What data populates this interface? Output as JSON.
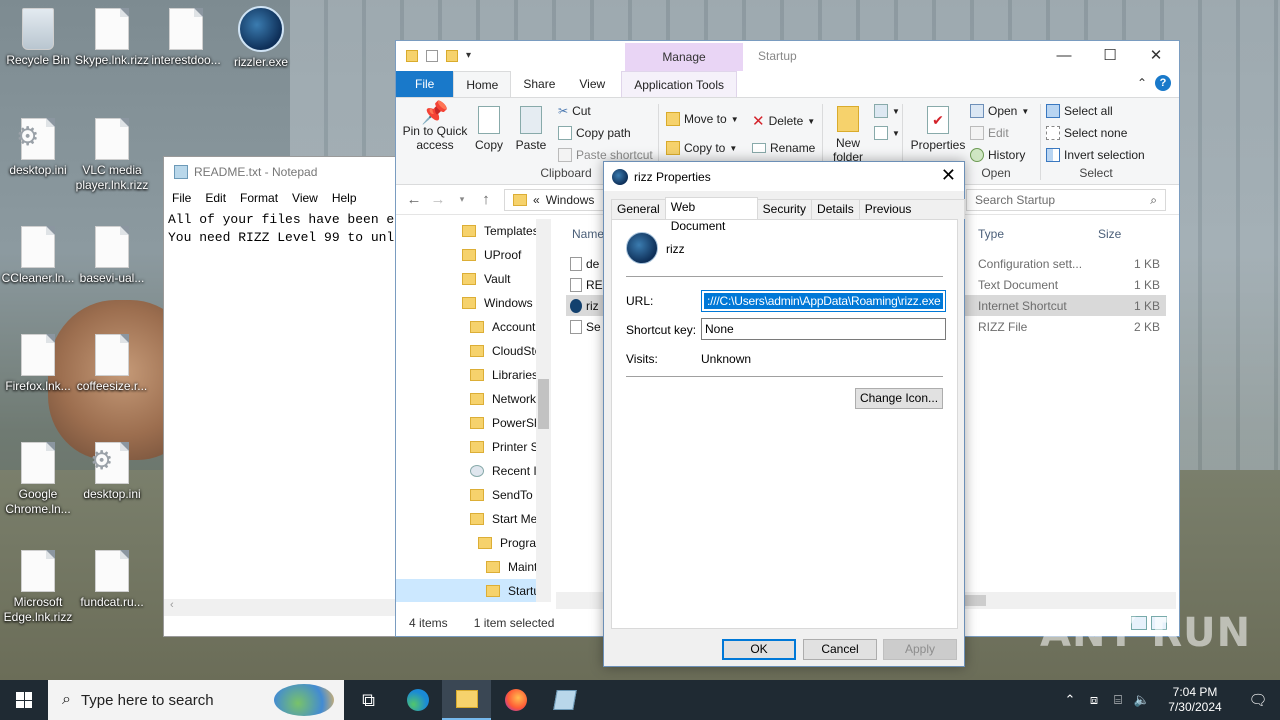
{
  "desktop": {
    "icons": [
      {
        "label": "Recycle Bin"
      },
      {
        "label": "Skype.lnk.rizz"
      },
      {
        "label": "interestdoo..."
      },
      {
        "label": "rizzler.exe"
      },
      {
        "label": "desktop.ini"
      },
      {
        "label": "VLC media player.lnk.rizz"
      },
      {
        "label": "CCleaner.ln..."
      },
      {
        "label": "basevi-ual..."
      },
      {
        "label": "Firefox.lnk..."
      },
      {
        "label": "coffeesize.r..."
      },
      {
        "label": "Google Chrome.ln..."
      },
      {
        "label": "desktop.ini"
      },
      {
        "label": "Microsoft Edge.lnk.rizz"
      },
      {
        "label": "fundcat.ru..."
      }
    ]
  },
  "notepad": {
    "title": "README.txt - Notepad",
    "menu": [
      "File",
      "Edit",
      "Format",
      "View",
      "Help"
    ],
    "line1": "All of your files have been e",
    "line2": "You need RIZZ Level 99 to unl"
  },
  "explorer": {
    "context_tab": "Manage",
    "window_title": "Startup",
    "tabs": {
      "file": "File",
      "home": "Home",
      "share": "Share",
      "view": "View",
      "app_tools": "Application Tools"
    },
    "ribbon": {
      "pin": "Pin to Quick access",
      "copy": "Copy",
      "paste": "Paste",
      "cut": "Cut",
      "copy_path": "Copy path",
      "paste_shortcut": "Paste shortcut",
      "clipboard_group": "Clipboard",
      "move_to": "Move to",
      "copy_to": "Copy to",
      "delete": "Delete",
      "rename": "Rename",
      "new_folder": "New folder",
      "properties": "Properties",
      "open": "Open",
      "edit": "Edit",
      "history": "History",
      "open_group": "Open",
      "select_all": "Select all",
      "select_none": "Select none",
      "invert_selection": "Invert selection",
      "select_group": "Select"
    },
    "address": {
      "crumb_prefix": "«",
      "crumb": "Windows",
      "search_placeholder": "Search Startup"
    },
    "nav_items": [
      "Templates",
      "UProof",
      "Vault",
      "Windows",
      "Account",
      "CloudSto",
      "Libraries",
      "Network",
      "PowerSh",
      "Printer Sl",
      "Recent It",
      "SendTo",
      "Start Mer",
      "Prograr",
      "Maint",
      "Startu"
    ],
    "columns": {
      "name": "Name",
      "type": "Type",
      "size": "Size"
    },
    "files": [
      {
        "name": "de",
        "type": "Configuration sett...",
        "size": "1 KB"
      },
      {
        "name": "RE",
        "type": "Text Document",
        "size": "1 KB"
      },
      {
        "name": "riz",
        "type": "Internet Shortcut",
        "size": "1 KB"
      },
      {
        "name": "Se",
        "type": "RIZZ File",
        "size": "2 KB"
      }
    ],
    "status": {
      "items": "4 items",
      "selected": "1 item selected"
    }
  },
  "properties": {
    "title": "rizz Properties",
    "tabs": [
      "General",
      "Web Document",
      "Security",
      "Details",
      "Previous Versions"
    ],
    "name": "rizz",
    "url_label": "URL:",
    "url_value": ":///C:\\Users\\admin\\AppData\\Roaming\\rizz.exe",
    "shortcut_label": "Shortcut key:",
    "shortcut_value": "None",
    "visits_label": "Visits:",
    "visits_value": "Unknown",
    "change_icon": "Change Icon...",
    "ok": "OK",
    "cancel": "Cancel",
    "apply": "Apply"
  },
  "taskbar": {
    "search_placeholder": "Type here to search",
    "time": "7:04 PM",
    "date": "7/30/2024"
  },
  "watermark": "ANY RUN"
}
